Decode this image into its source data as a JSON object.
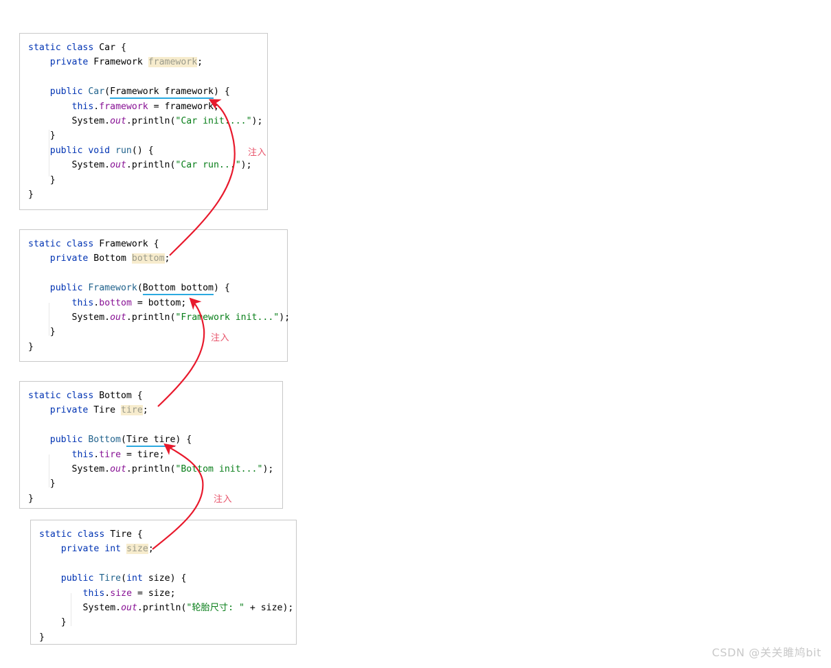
{
  "blocks": [
    {
      "name": "car",
      "lines": [
        [
          {
            "t": "static ",
            "c": "kw"
          },
          {
            "t": "class ",
            "c": "kw"
          },
          {
            "t": "Car {",
            "c": "plain"
          }
        ],
        [
          {
            "t": "    ",
            "c": "plain"
          },
          {
            "t": "private ",
            "c": "kw"
          },
          {
            "t": "Framework ",
            "c": "plain"
          },
          {
            "t": "framework",
            "c": "field-dim"
          },
          {
            "t": ";",
            "c": "plain"
          }
        ],
        [
          {
            "t": "",
            "c": "plain"
          }
        ],
        [
          {
            "t": "    ",
            "c": "plain"
          },
          {
            "t": "public ",
            "c": "kw"
          },
          {
            "t": "Car",
            "c": "cls"
          },
          {
            "t": "(",
            "c": "plain"
          },
          {
            "t": "Framework framework",
            "c": "plain",
            "u": true
          },
          {
            "t": ") {",
            "c": "plain"
          }
        ],
        [
          {
            "t": "        ",
            "c": "plain"
          },
          {
            "t": "this",
            "c": "kw"
          },
          {
            "t": ".",
            "c": "plain"
          },
          {
            "t": "framework",
            "c": "field"
          },
          {
            "t": " = framework;",
            "c": "plain"
          }
        ],
        [
          {
            "t": "        System.",
            "c": "plain"
          },
          {
            "t": "out",
            "c": "ital"
          },
          {
            "t": ".println(",
            "c": "plain"
          },
          {
            "t": "\"Car init....\"",
            "c": "str"
          },
          {
            "t": ");",
            "c": "plain"
          }
        ],
        [
          {
            "t": "    }",
            "c": "plain"
          }
        ],
        [
          {
            "t": "    ",
            "c": "plain"
          },
          {
            "t": "public ",
            "c": "kw"
          },
          {
            "t": "void ",
            "c": "kw"
          },
          {
            "t": "run",
            "c": "cls"
          },
          {
            "t": "() {",
            "c": "plain"
          }
        ],
        [
          {
            "t": "        System.",
            "c": "plain"
          },
          {
            "t": "out",
            "c": "ital"
          },
          {
            "t": ".println(",
            "c": "plain"
          },
          {
            "t": "\"Car run...\"",
            "c": "str"
          },
          {
            "t": ");",
            "c": "plain"
          }
        ],
        [
          {
            "t": "    }",
            "c": "plain"
          }
        ],
        [
          {
            "t": "}",
            "c": "plain"
          }
        ]
      ]
    },
    {
      "name": "framework",
      "lines": [
        [
          {
            "t": "static ",
            "c": "kw"
          },
          {
            "t": "class ",
            "c": "kw"
          },
          {
            "t": "Framework {",
            "c": "plain"
          }
        ],
        [
          {
            "t": "    ",
            "c": "plain"
          },
          {
            "t": "private ",
            "c": "kw"
          },
          {
            "t": "Bottom ",
            "c": "plain"
          },
          {
            "t": "bottom",
            "c": "field-dim"
          },
          {
            "t": ";",
            "c": "plain"
          }
        ],
        [
          {
            "t": "",
            "c": "plain"
          }
        ],
        [
          {
            "t": "    ",
            "c": "plain"
          },
          {
            "t": "public ",
            "c": "kw"
          },
          {
            "t": "Framework",
            "c": "cls"
          },
          {
            "t": "(",
            "c": "plain"
          },
          {
            "t": "Bottom bottom",
            "c": "plain",
            "u": true
          },
          {
            "t": ") {",
            "c": "plain"
          }
        ],
        [
          {
            "t": "        ",
            "c": "plain"
          },
          {
            "t": "this",
            "c": "kw"
          },
          {
            "t": ".",
            "c": "plain"
          },
          {
            "t": "bottom",
            "c": "field"
          },
          {
            "t": " = bottom;",
            "c": "plain"
          }
        ],
        [
          {
            "t": "        System.",
            "c": "plain"
          },
          {
            "t": "out",
            "c": "ital"
          },
          {
            "t": ".println(",
            "c": "plain"
          },
          {
            "t": "\"Framework init...\"",
            "c": "str"
          },
          {
            "t": ");",
            "c": "plain"
          }
        ],
        [
          {
            "t": "    }",
            "c": "plain"
          }
        ],
        [
          {
            "t": "}",
            "c": "plain"
          }
        ]
      ]
    },
    {
      "name": "bottom",
      "lines": [
        [
          {
            "t": "static ",
            "c": "kw"
          },
          {
            "t": "class ",
            "c": "kw"
          },
          {
            "t": "Bottom {",
            "c": "plain"
          }
        ],
        [
          {
            "t": "    ",
            "c": "plain"
          },
          {
            "t": "private ",
            "c": "kw"
          },
          {
            "t": "Tire ",
            "c": "plain"
          },
          {
            "t": "tire",
            "c": "field-dim"
          },
          {
            "t": ";",
            "c": "plain"
          }
        ],
        [
          {
            "t": "",
            "c": "plain"
          }
        ],
        [
          {
            "t": "    ",
            "c": "plain"
          },
          {
            "t": "public ",
            "c": "kw"
          },
          {
            "t": "Bottom",
            "c": "cls"
          },
          {
            "t": "(",
            "c": "plain"
          },
          {
            "t": "Tire tire",
            "c": "plain",
            "u": true
          },
          {
            "t": ") {",
            "c": "plain"
          }
        ],
        [
          {
            "t": "        ",
            "c": "plain"
          },
          {
            "t": "this",
            "c": "kw"
          },
          {
            "t": ".",
            "c": "plain"
          },
          {
            "t": "tire",
            "c": "field"
          },
          {
            "t": " = tire;",
            "c": "plain"
          }
        ],
        [
          {
            "t": "        System.",
            "c": "plain"
          },
          {
            "t": "out",
            "c": "ital"
          },
          {
            "t": ".println(",
            "c": "plain"
          },
          {
            "t": "\"Bottom init...\"",
            "c": "str"
          },
          {
            "t": ");",
            "c": "plain"
          }
        ],
        [
          {
            "t": "    }",
            "c": "plain"
          }
        ],
        [
          {
            "t": "}",
            "c": "plain"
          }
        ]
      ]
    },
    {
      "name": "tire",
      "lines": [
        [
          {
            "t": "static ",
            "c": "kw"
          },
          {
            "t": "class ",
            "c": "kw"
          },
          {
            "t": "Tire {",
            "c": "plain"
          }
        ],
        [
          {
            "t": "    ",
            "c": "plain"
          },
          {
            "t": "private ",
            "c": "kw"
          },
          {
            "t": "int ",
            "c": "kw"
          },
          {
            "t": "size",
            "c": "field-dim"
          },
          {
            "t": ";",
            "c": "plain"
          }
        ],
        [
          {
            "t": "",
            "c": "plain"
          }
        ],
        [
          {
            "t": "    ",
            "c": "plain"
          },
          {
            "t": "public ",
            "c": "kw"
          },
          {
            "t": "Tire",
            "c": "cls"
          },
          {
            "t": "(",
            "c": "plain"
          },
          {
            "t": "int",
            "c": "kw"
          },
          {
            "t": " size) {",
            "c": "plain"
          }
        ],
        [
          {
            "t": "        ",
            "c": "plain"
          },
          {
            "t": "this",
            "c": "kw"
          },
          {
            "t": ".",
            "c": "plain"
          },
          {
            "t": "size",
            "c": "field"
          },
          {
            "t": " = size;",
            "c": "plain"
          }
        ],
        [
          {
            "t": "        System.",
            "c": "plain"
          },
          {
            "t": "out",
            "c": "ital"
          },
          {
            "t": ".println(",
            "c": "plain"
          },
          {
            "t": "\"轮胎尺寸: \"",
            "c": "str"
          },
          {
            "t": " + size);",
            "c": "plain"
          }
        ],
        [
          {
            "t": "    }",
            "c": "plain"
          }
        ],
        [
          {
            "t": "}",
            "c": "plain"
          }
        ]
      ]
    }
  ],
  "annotations": {
    "inject_1": "注入",
    "inject_2": "注入",
    "inject_3": "注入"
  },
  "watermark": "CSDN @关关雎鸠bit",
  "colors": {
    "arrow": "#e8192c",
    "keyword": "#0033B3",
    "string": "#067D17",
    "field": "#871094",
    "field_highlight_bg": "#f7eccd",
    "param_underline": "#2aa9e0",
    "box_border": "#c8c8c8",
    "annotation": "#e8536a"
  }
}
